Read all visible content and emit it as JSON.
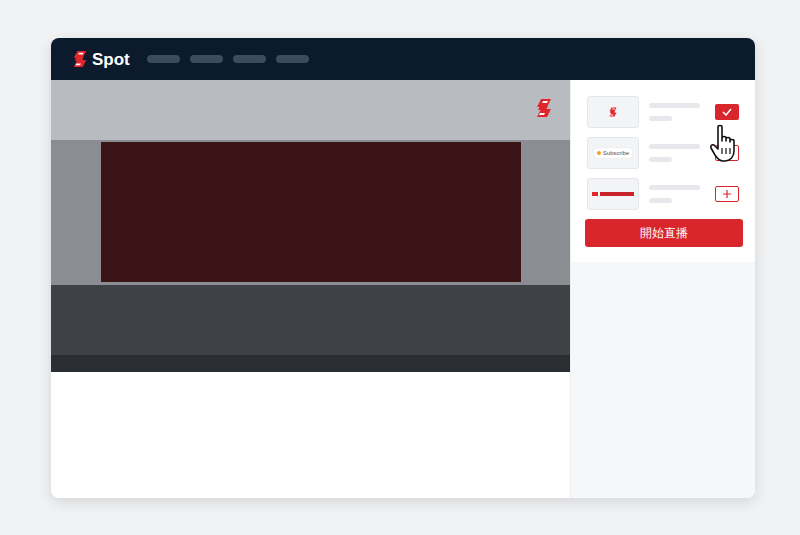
{
  "app": {
    "logo": "Spot"
  },
  "overlays": [
    {
      "kind": "logo",
      "added": true
    },
    {
      "kind": "subscribe",
      "label": "Subscribe",
      "added": false
    },
    {
      "kind": "banner",
      "added": false
    }
  ],
  "start_button": "開始直播"
}
